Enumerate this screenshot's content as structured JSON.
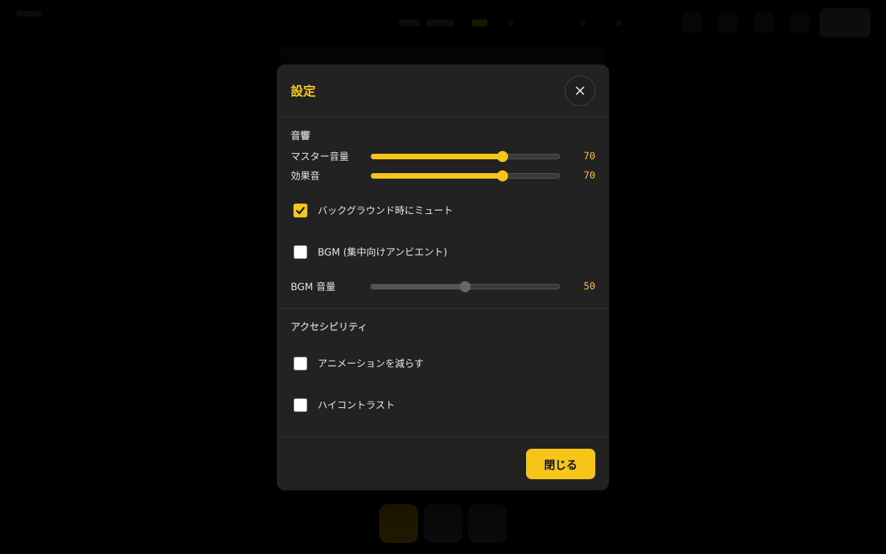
{
  "colors": {
    "accent": "#f5c518",
    "panel": "#222222",
    "backdrop": "#000000"
  },
  "modal": {
    "title": "設定",
    "close_icon": "close-icon",
    "audio": {
      "title": "音響",
      "master_volume": {
        "label": "マスター音量",
        "value": "70",
        "level": 0.7
      },
      "sfx_volume": {
        "label": "効果音",
        "value": "70",
        "level": 0.7
      },
      "mute_in_background": {
        "label": "バックグラウンド時にミュート",
        "checked": true
      },
      "bgm": {
        "label": "BGM (集中向けアンビエント)",
        "checked": false
      },
      "bgm_volume": {
        "label": "BGM 音量",
        "value": "50",
        "level": 0.5,
        "disabled": true
      }
    },
    "accessibility": {
      "title": "アクセシビリティ",
      "reduce_motion": {
        "label": "アニメーションを減らす",
        "checked": false
      },
      "high_contrast": {
        "label": "ハイコントラスト",
        "checked": false
      }
    },
    "footer": {
      "close_label": "閉じる"
    }
  }
}
